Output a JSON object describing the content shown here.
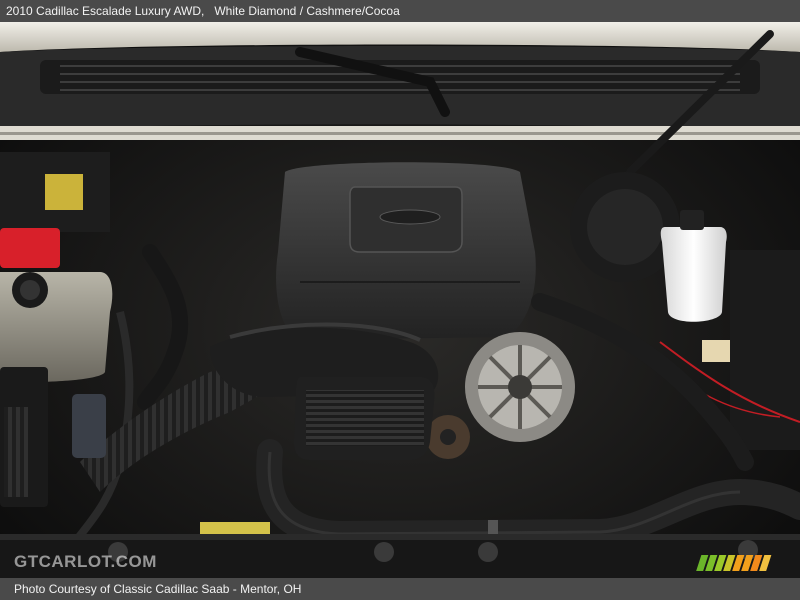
{
  "caption": {
    "vehicle": "2010 Cadillac Escalade Luxury AWD,",
    "color": "White Diamond / Cashmere/Cocoa"
  },
  "photo": {
    "subject": "engine-bay"
  },
  "watermark": {
    "text": "GTCARLOT.COM"
  },
  "footer": {
    "credit": "Photo Courtesy of Classic Cadillac Saab - Mentor, OH"
  },
  "colors": {
    "bar": "#4a4a4a",
    "bar_text": "#f2f2f2",
    "hood": "#e9e6dc",
    "engine_cover": "#3a3a3a",
    "hose": "#1c1c1c",
    "reservoir": "#f4f4f4",
    "red_cap": "#d8202a",
    "logo_green": "#7bbf2a",
    "logo_orange": "#f2a01c"
  }
}
